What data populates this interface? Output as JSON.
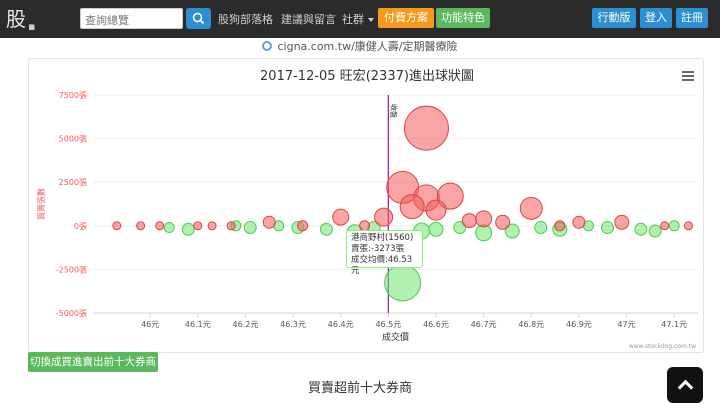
{
  "header": {
    "logo_text": "股",
    "search_placeholder": "查詢總覽",
    "nav": [
      "股狗部落格",
      "建議與留言",
      "社群"
    ],
    "paid_plan": "付費方案",
    "features": "功能特色",
    "mobile": "行動版",
    "login": "登入",
    "register": "註冊"
  },
  "ad": {
    "text": "cigna.com.tw/康健人壽/定期醫療險"
  },
  "chart": {
    "title": "2017-12-05 旺宏(2337)進出球狀圖",
    "ylabel": "買賣張數",
    "xlabel": "成交價",
    "close_label": "收盤",
    "credit": "www.stockdog.com.tw",
    "y_ticks": [
      "7500張",
      "5000張",
      "2500張",
      "0張",
      "-2500張",
      "-5000張"
    ],
    "x_ticks": [
      "46元",
      "46.1元",
      "46.2元",
      "46.3元",
      "46.4元",
      "46.5元",
      "46.6元",
      "46.7元",
      "46.8元",
      "46.9元",
      "47元",
      "47.1元"
    ]
  },
  "tooltip": {
    "broker": "港商野村(1560)",
    "vol": "賣張:-3273張",
    "avg": "成交均價:46.53元"
  },
  "switch_button": "切換成買進賣出前十大券商",
  "section_title": "買賣超前十大券商",
  "colors": {
    "buy": "#f45b5b",
    "sell": "#6fe36f",
    "close_line": "#9c27b0",
    "accent_blue": "#2d8fd2",
    "accent_orange": "#f39a1d",
    "accent_green": "#5cb85c"
  },
  "chart_data": {
    "type": "scatter",
    "title": "2017-12-05 旺宏(2337)進出球狀圖",
    "xlabel": "成交價",
    "ylabel": "買賣張數",
    "xlim": [
      45.88,
      47.15
    ],
    "ylim": [
      -5000,
      7500
    ],
    "close_price": 46.5,
    "series": [
      {
        "color": "#f45b5b",
        "points": [
          [
            46.58,
            5600,
            22
          ],
          [
            46.53,
            2200,
            16
          ],
          [
            46.58,
            1600,
            13
          ],
          [
            46.55,
            1100,
            12
          ],
          [
            46.63,
            1700,
            13
          ],
          [
            46.6,
            900,
            10
          ],
          [
            46.8,
            1000,
            11
          ],
          [
            46.49,
            500,
            9
          ],
          [
            46.4,
            500,
            8
          ],
          [
            46.7,
            400,
            8
          ],
          [
            46.74,
            200,
            7
          ],
          [
            46.9,
            200,
            6
          ],
          [
            46.25,
            200,
            6
          ],
          [
            46.67,
            300,
            7
          ],
          [
            46.99,
            200,
            7
          ],
          [
            45.93,
            0,
            4
          ],
          [
            45.98,
            0,
            4
          ],
          [
            46.02,
            0,
            4
          ],
          [
            46.1,
            0,
            4
          ],
          [
            46.13,
            0,
            4
          ],
          [
            46.17,
            0,
            4
          ],
          [
            46.32,
            0,
            5
          ],
          [
            46.45,
            0,
            5
          ],
          [
            46.86,
            0,
            5
          ],
          [
            47.08,
            0,
            4
          ],
          [
            47.13,
            0,
            4
          ]
        ]
      },
      {
        "color": "#6fe36f",
        "points": [
          [
            46.53,
            -3273,
            18
          ],
          [
            46.43,
            -400,
            8
          ],
          [
            46.57,
            -300,
            8
          ],
          [
            46.6,
            -200,
            7
          ],
          [
            46.7,
            -400,
            8
          ],
          [
            46.76,
            -300,
            7
          ],
          [
            46.86,
            -200,
            7
          ],
          [
            46.96,
            -100,
            6
          ],
          [
            47.03,
            -200,
            6
          ],
          [
            47.06,
            -300,
            6
          ],
          [
            46.08,
            -200,
            6
          ],
          [
            46.21,
            -100,
            6
          ],
          [
            46.31,
            -100,
            6
          ],
          [
            46.37,
            -200,
            6
          ],
          [
            46.27,
            0,
            5
          ],
          [
            46.47,
            -100,
            6
          ],
          [
            46.65,
            -100,
            6
          ],
          [
            46.82,
            -100,
            6
          ],
          [
            46.92,
            0,
            5
          ],
          [
            47.1,
            0,
            5
          ],
          [
            46.18,
            0,
            5
          ],
          [
            46.04,
            -100,
            5
          ]
        ]
      }
    ]
  }
}
